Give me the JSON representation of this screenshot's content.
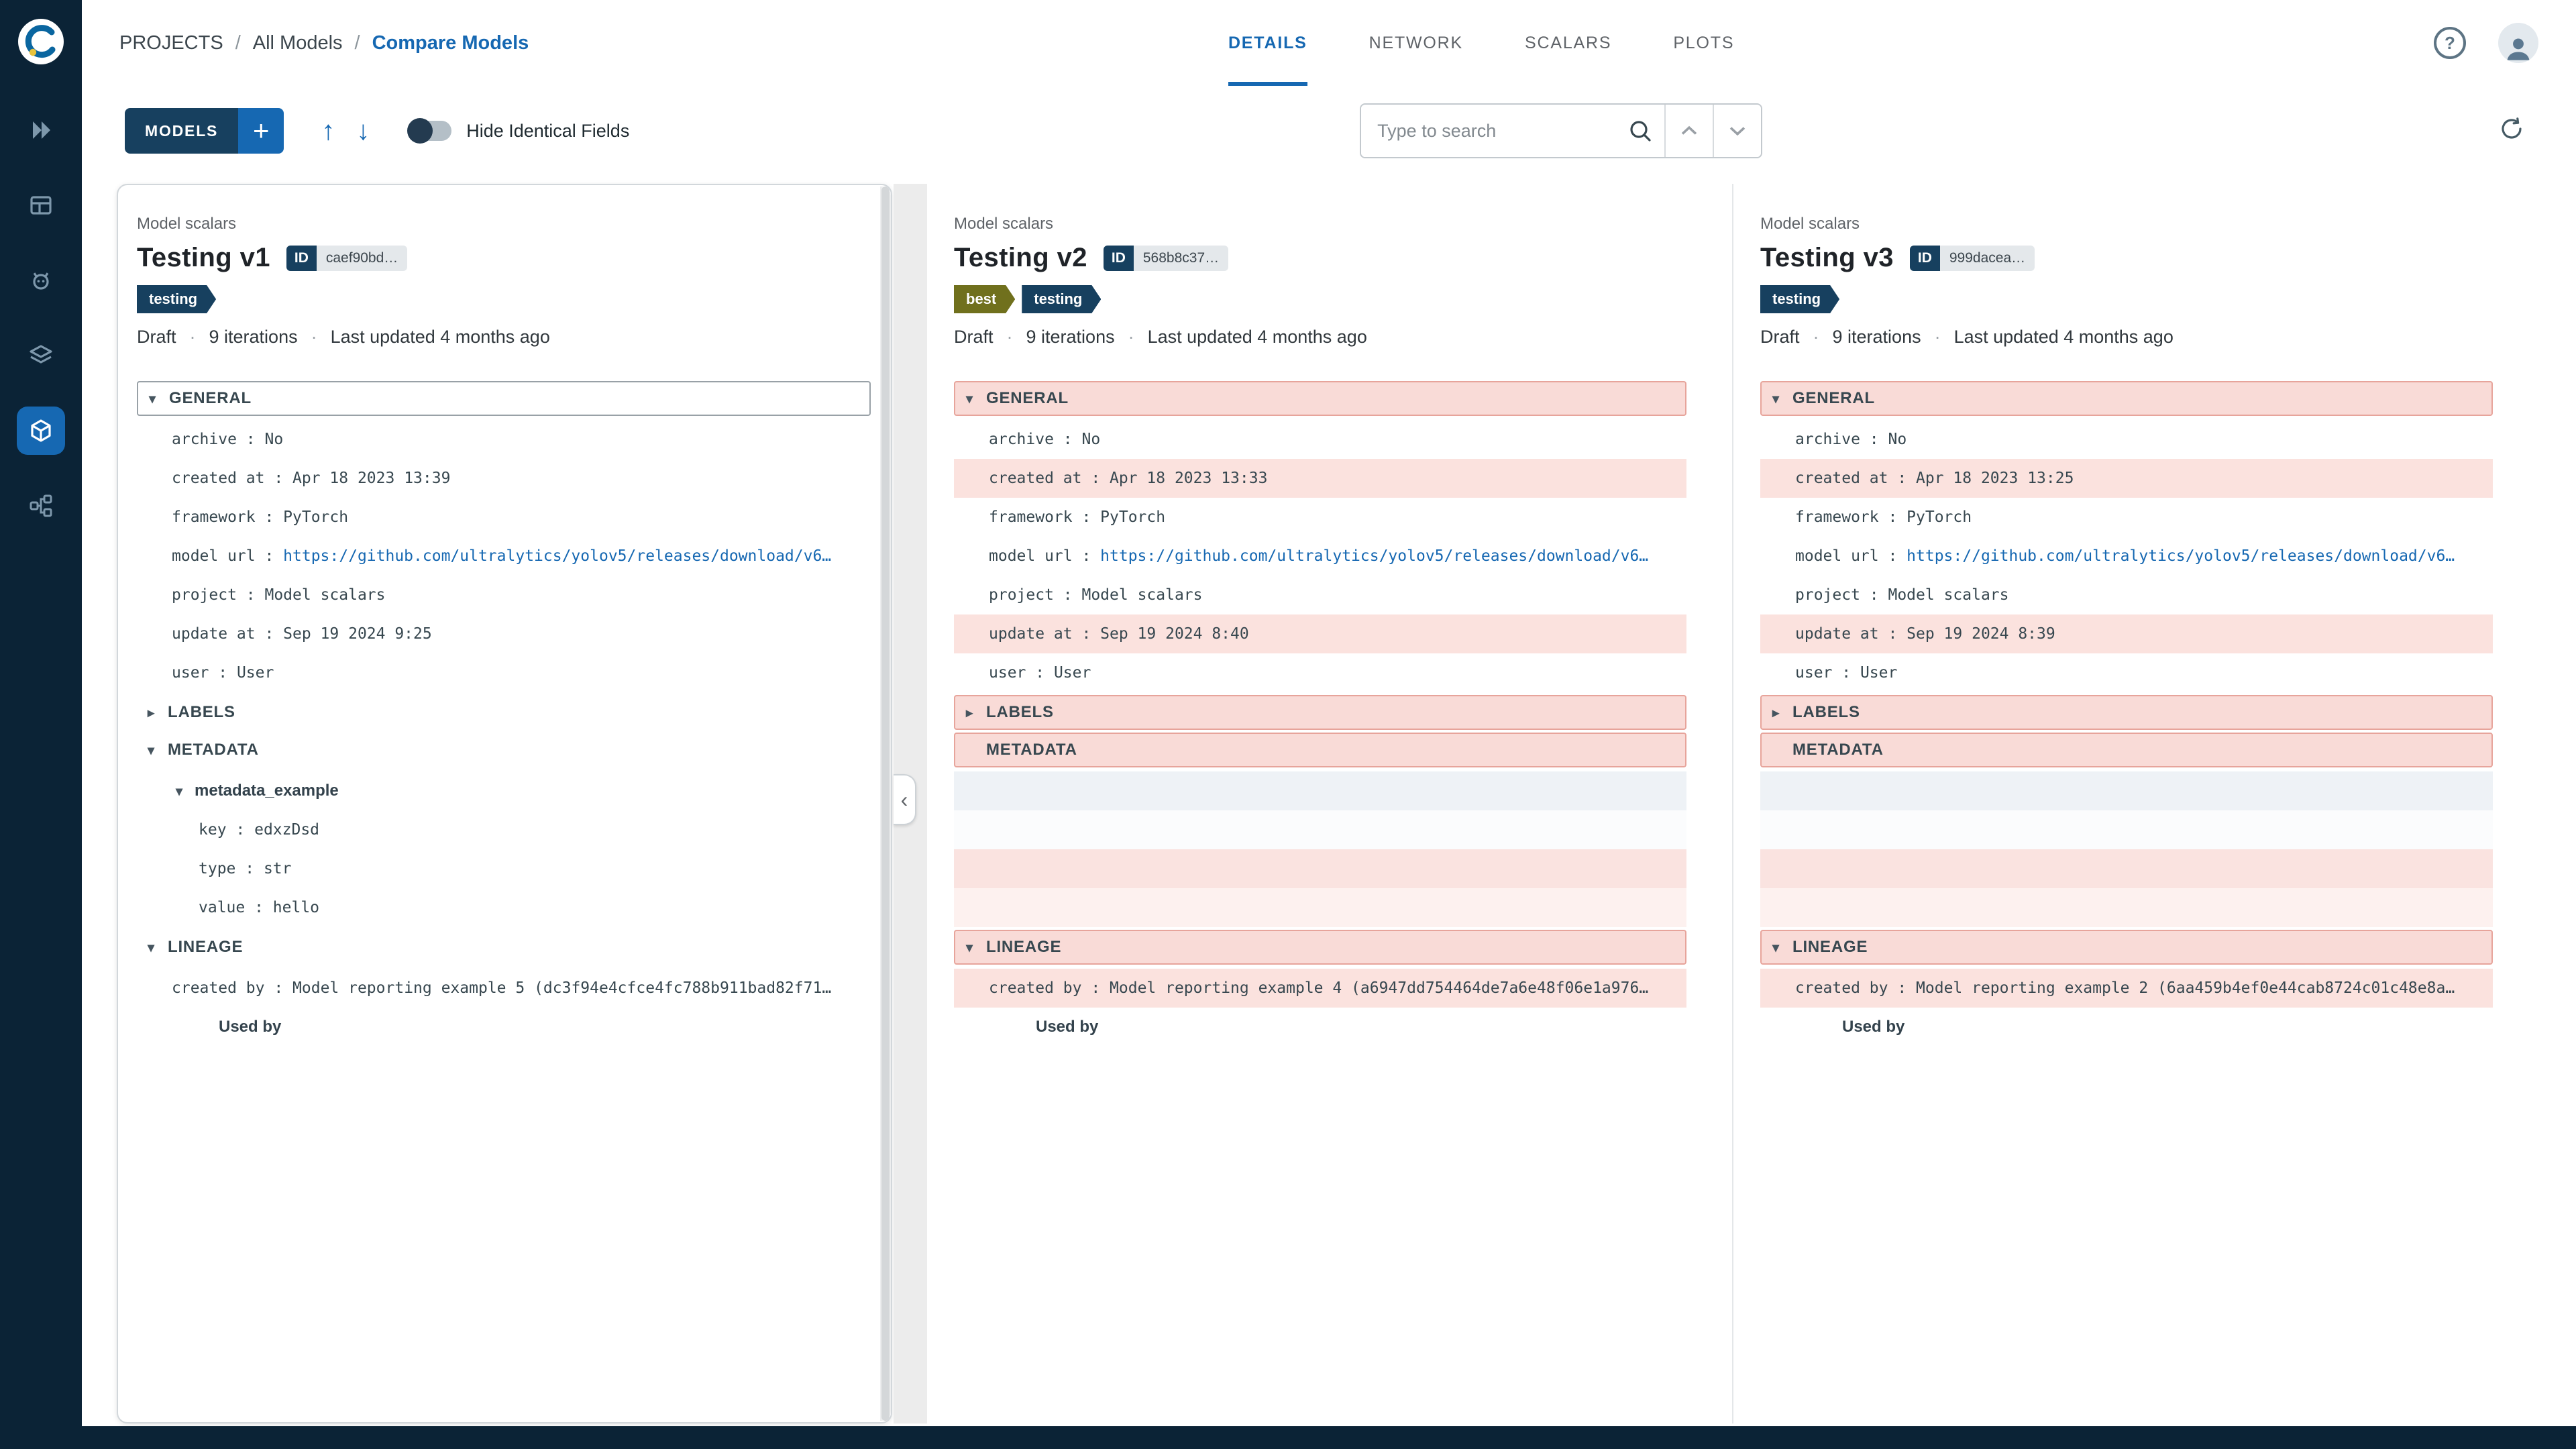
{
  "colors": {
    "accent_blue": "#1668b2",
    "sidebar_navy": "#0b2336",
    "chip_navy": "#17405f",
    "tag_best_olive": "#70701d",
    "diff_pink_bg": "#f9dbd7",
    "diff_pink_border": "#e7a49b",
    "link_blue": "#1668b2"
  },
  "sidebar": {
    "items": [
      "experiments",
      "projects-table",
      "debugger",
      "artifacts",
      "model-registry",
      "pipelines"
    ],
    "active_item": "model-registry"
  },
  "header": {
    "breadcrumb": [
      "PROJECTS",
      "All Models",
      "Compare Models"
    ],
    "separator": "/",
    "tabs": [
      {
        "label": "DETAILS",
        "active": true
      },
      {
        "label": "NETWORK",
        "active": false
      },
      {
        "label": "SCALARS",
        "active": false
      },
      {
        "label": "PLOTS",
        "active": false
      }
    ]
  },
  "toolbar": {
    "models_button": "MODELS",
    "add_button": "+",
    "hide_identical_label": "Hide Identical Fields",
    "hide_identical_on": false,
    "search_placeholder": "Type to search"
  },
  "icons": {
    "chevron_down": "▾",
    "chevron_right": "▸",
    "arrow_up": "↑",
    "arrow_down": "↓",
    "collapse_left": "‹",
    "help": "?",
    "dot": "·"
  },
  "section_labels": {
    "general": "GENERAL",
    "labels": "LABELS",
    "metadata": "METADATA",
    "lineage": "LINEAGE",
    "used_by": "Used by"
  },
  "models": [
    {
      "subtitle": "Model scalars",
      "title": "Testing v1",
      "id_label": "ID",
      "id_value": "caef90bd…",
      "tags": [
        "testing"
      ],
      "status": "Draft",
      "iterations": "9 iterations",
      "updated": "Last updated 4 months ago",
      "general": [
        {
          "key": "archive",
          "value": "No"
        },
        {
          "key": "created at",
          "value": "Apr 18 2023 13:39"
        },
        {
          "key": "framework",
          "value": "PyTorch"
        },
        {
          "key": "model url",
          "value": "https://github.com/ultralytics/yolov5/releases/download/v6…",
          "link": true
        },
        {
          "key": "project",
          "value": "Model scalars"
        },
        {
          "key": "update at",
          "value": "Sep 19 2024 9:25"
        },
        {
          "key": "user",
          "value": "User"
        }
      ],
      "metadata_group": "metadata_example",
      "metadata_rows": [
        {
          "key": "key",
          "value": "edxzDsd"
        },
        {
          "key": "type",
          "value": "str"
        },
        {
          "key": "value",
          "value": "hello"
        }
      ],
      "lineage": {
        "key": "created by",
        "value": "Model reporting example 5 (dc3f94e4cfce4fc788b911bad82f71…"
      }
    },
    {
      "subtitle": "Model scalars",
      "title": "Testing v2",
      "id_label": "ID",
      "id_value": "568b8c37…",
      "tags": [
        "best",
        "testing"
      ],
      "status": "Draft",
      "iterations": "9 iterations",
      "updated": "Last updated 4 months ago",
      "general": [
        {
          "key": "archive",
          "value": "No"
        },
        {
          "key": "created at",
          "value": "Apr 18 2023 13:33",
          "diff": true
        },
        {
          "key": "framework",
          "value": "PyTorch"
        },
        {
          "key": "model url",
          "value": "https://github.com/ultralytics/yolov5/releases/download/v6…",
          "link": true
        },
        {
          "key": "project",
          "value": "Model scalars"
        },
        {
          "key": "update at",
          "value": "Sep 19 2024 8:40",
          "diff": true
        },
        {
          "key": "user",
          "value": "User"
        }
      ],
      "lineage": {
        "key": "created by",
        "value": "Model reporting example 4 (a6947dd754464de7a6e48f06e1a976…",
        "diff": true
      }
    },
    {
      "subtitle": "Model scalars",
      "title": "Testing v3",
      "id_label": "ID",
      "id_value": "999dacea…",
      "tags": [
        "testing"
      ],
      "status": "Draft",
      "iterations": "9 iterations",
      "updated": "Last updated 4 months ago",
      "general": [
        {
          "key": "archive",
          "value": "No"
        },
        {
          "key": "created at",
          "value": "Apr 18 2023 13:25",
          "diff": true
        },
        {
          "key": "framework",
          "value": "PyTorch"
        },
        {
          "key": "model url",
          "value": "https://github.com/ultralytics/yolov5/releases/download/v6…",
          "link": true
        },
        {
          "key": "project",
          "value": "Model scalars"
        },
        {
          "key": "update at",
          "value": "Sep 19 2024 8:39",
          "diff": true
        },
        {
          "key": "user",
          "value": "User"
        }
      ],
      "lineage": {
        "key": "created by",
        "value": "Model reporting example 2 (6aa459b4ef0e44cab8724c01c48e8a…",
        "diff": true
      }
    }
  ]
}
